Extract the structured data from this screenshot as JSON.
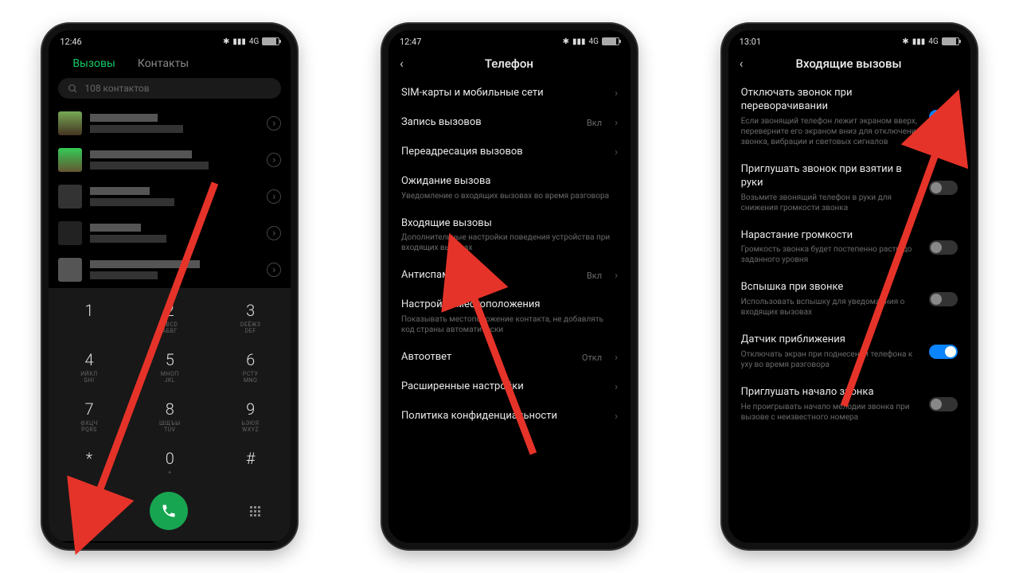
{
  "s1": {
    "time": "12:46",
    "net": "4G",
    "tabs": {
      "calls": "Вызовы",
      "contacts": "Контакты"
    },
    "search_placeholder": "108 контактов",
    "keys": [
      [
        "1",
        ""
      ],
      [
        "2",
        "ABCD\nАБВГ"
      ],
      [
        "3",
        "DEЁЖЗ\nDEF"
      ],
      [
        "4",
        "ИЙКЛ\nGHI"
      ],
      [
        "5",
        "МНОП\nJKL"
      ],
      [
        "6",
        "РСТУ\nMNO"
      ],
      [
        "7",
        "ФХЦЧ\nPQRS"
      ],
      [
        "8",
        "ШЩЪЫ\nTUV"
      ],
      [
        "9",
        "ЬЭЮЯ\nWXYZ"
      ],
      [
        "*",
        ""
      ],
      [
        "0",
        "+"
      ],
      [
        "#",
        ""
      ]
    ]
  },
  "s2": {
    "time": "12:47",
    "title": "Телефон",
    "items": [
      {
        "label": "SIM-карты и мобильные сети",
        "arrow": true
      },
      {
        "label": "Запись вызовов",
        "value": "Вкл",
        "arrow": true
      },
      {
        "label": "Переадресация вызовов",
        "arrow": true
      },
      {
        "label": "Ожидание вызова",
        "desc": "Уведомление о входящих вызовах во время разговора"
      },
      {
        "label": "Входящие вызовы",
        "desc": "Дополнительные настройки поведения устройства при входящих вызовах"
      },
      {
        "label": "Антиспам",
        "value": "Вкл",
        "arrow": true
      },
      {
        "label": "Настройки местоположения",
        "desc": "Показывать местоположение контакта, не добавлять код страны автоматически"
      },
      {
        "label": "Автоответ",
        "value": "Откл",
        "arrow": true
      },
      {
        "label": "Расширенные настройки",
        "arrow": true
      },
      {
        "label": "Политика конфиденциальности",
        "arrow": true
      }
    ]
  },
  "s3": {
    "time": "13:01",
    "title": "Входящие вызовы",
    "items": [
      {
        "label": "Отключать звонок при переворачивании",
        "desc": "Если звонящий телефон лежит экраном вверх, переверните его экраном вниз для отключения звонка, вибрации и световых сигналов",
        "toggle": true,
        "on": true
      },
      {
        "label": "Приглушать звонок при взятии в руки",
        "desc": "Возьмите звонящий телефон в руки для снижения громкости звонка",
        "toggle": true,
        "on": false
      },
      {
        "label": "Нарастание громкости",
        "desc": "Громкость звонка будет постепенно расти до заданного уровня",
        "toggle": true,
        "on": false
      },
      {
        "label": "Вспышка при звонке",
        "desc": "Использовать вспышку для уведомления о входящих вызовах",
        "toggle": true,
        "on": false
      },
      {
        "label": "Датчик приближения",
        "desc": "Отключать экран при поднесении телефона к уху во время разговора",
        "toggle": true,
        "on": true
      },
      {
        "label": "Приглушать начало звонка",
        "desc": "Не проигрывать начало мелодии звонка при вызове с неизвестного номера",
        "toggle": true,
        "on": false
      }
    ]
  }
}
